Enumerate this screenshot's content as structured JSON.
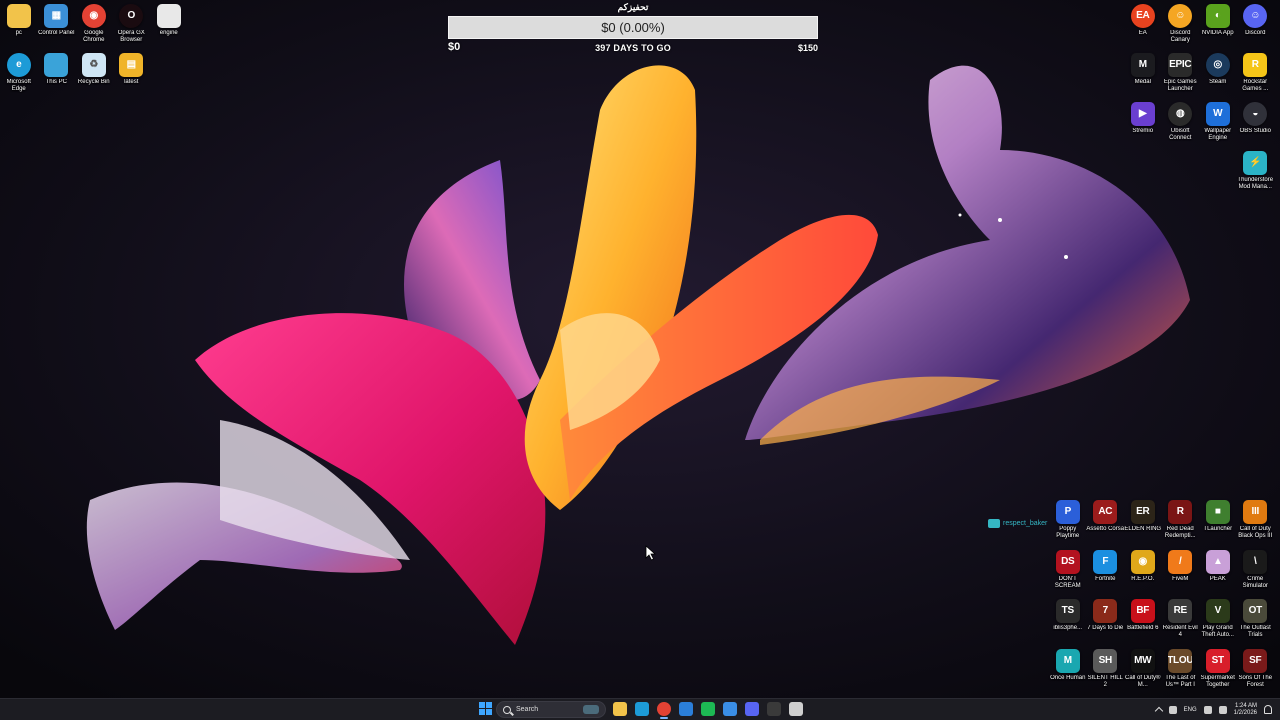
{
  "goal_widget": {
    "title": "تحفيزكم",
    "amount": "$0 (0.00%)",
    "progress_percent": 0.0,
    "min_label": "$0",
    "days_label": "397 DAYS TO GO",
    "max_label": "$150"
  },
  "desktop_left": [
    {
      "label": "pc",
      "icon": "folder-icon",
      "color": "#f2c34a",
      "glyph": ""
    },
    {
      "label": "Control Panel",
      "icon": "control-panel-icon",
      "color": "#3b8fd6",
      "glyph": "▦"
    },
    {
      "label": "Google Chrome",
      "icon": "chrome-icon",
      "color": "#e34234",
      "glyph": "◉",
      "round": true
    },
    {
      "label": "Opera GX Browser",
      "icon": "opera-gx-icon",
      "color": "#1a0b10",
      "glyph": "O",
      "round": true
    },
    {
      "label": "engine",
      "icon": "file-icon",
      "color": "#e8e8e8",
      "glyph": ""
    },
    {
      "label": "Microsoft Edge",
      "icon": "edge-icon",
      "color": "#1d9bd7",
      "glyph": "e",
      "round": true
    },
    {
      "label": "This PC",
      "icon": "monitor-icon",
      "color": "#3aa3d9",
      "glyph": ""
    },
    {
      "label": "Recycle Bin",
      "icon": "recycle-bin-icon",
      "color": "#cfe6f5",
      "glyph": "♻"
    },
    {
      "label": "latest",
      "icon": "zip-folder-icon",
      "color": "#f0b429",
      "glyph": "▤"
    }
  ],
  "desktop_right_top": [
    {
      "label": "EA",
      "icon": "ea-icon",
      "color": "#e8431f",
      "glyph": "EA",
      "round": true
    },
    {
      "label": "Discord Canary",
      "icon": "discord-canary-icon",
      "color": "#f5a623",
      "glyph": "☺",
      "round": true
    },
    {
      "label": "NVIDIA App",
      "icon": "nvidia-icon",
      "color": "#5aa21d",
      "glyph": "◐"
    },
    {
      "label": "Discord",
      "icon": "discord-icon",
      "color": "#5865f2",
      "glyph": "☺",
      "round": true
    },
    {
      "label": "Medal",
      "icon": "medal-icon",
      "color": "#1b1b1f",
      "glyph": "M"
    },
    {
      "label": "Epic Games Launcher",
      "icon": "epic-games-icon",
      "color": "#2a2a2a",
      "glyph": "EPIC"
    },
    {
      "label": "Steam",
      "icon": "steam-icon",
      "color": "#1b3a5c",
      "glyph": "◎",
      "round": true
    },
    {
      "label": "Rockstar Games ...",
      "icon": "rockstar-icon",
      "color": "#f5c518",
      "glyph": "R"
    },
    {
      "label": "Stremio",
      "icon": "stremio-icon",
      "color": "#6a3fd0",
      "glyph": "▶"
    },
    {
      "label": "Ubisoft Connect",
      "icon": "ubisoft-icon",
      "color": "#2a2a2a",
      "glyph": "◍",
      "round": true
    },
    {
      "label": "Wallpaper Engine",
      "icon": "wallpaper-engine-icon",
      "color": "#1e6fd9",
      "glyph": "W"
    },
    {
      "label": "OBS Studio",
      "icon": "obs-icon",
      "color": "#30313a",
      "glyph": "◒",
      "round": true
    },
    {
      "label": "",
      "icon": "",
      "color": "",
      "glyph": "",
      "empty": true
    },
    {
      "label": "",
      "icon": "",
      "color": "",
      "glyph": "",
      "empty": true
    },
    {
      "label": "",
      "icon": "",
      "color": "",
      "glyph": "",
      "empty": true
    },
    {
      "label": "Thunderstore Mod Mana...",
      "icon": "thunderstore-icon",
      "color": "#2bb3c6",
      "glyph": "⚡"
    }
  ],
  "desktop_right_bottom": [
    {
      "label": "Poppy Playtime",
      "icon": "poppy-playtime-icon",
      "color": "#2b5fd9",
      "glyph": "P"
    },
    {
      "label": "Assetto Corsa",
      "icon": "assetto-corsa-icon",
      "color": "#9b1c1c",
      "glyph": "AC"
    },
    {
      "label": "ELDEN RING",
      "icon": "elden-ring-icon",
      "color": "#2c2418",
      "glyph": "ER"
    },
    {
      "label": "Red Dead Redempti...",
      "icon": "red-dead-icon",
      "color": "#7a1515",
      "glyph": "R"
    },
    {
      "label": "TLauncher",
      "icon": "tlauncher-icon",
      "color": "#3f7f2f",
      "glyph": "■"
    },
    {
      "label": "Call of Duty Black Ops III",
      "icon": "black-ops-icon",
      "color": "#e07a10",
      "glyph": "III"
    },
    {
      "label": "DON'T SCREAM",
      "icon": "dont-scream-icon",
      "color": "#b3121f",
      "glyph": "DS"
    },
    {
      "label": "Fortnite",
      "icon": "fortnite-icon",
      "color": "#1b8fe0",
      "glyph": "F"
    },
    {
      "label": "R.E.P.O.",
      "icon": "repo-icon",
      "color": "#e0a81a",
      "glyph": "◉"
    },
    {
      "label": "FiveM",
      "icon": "fivem-icon",
      "color": "#f07a1a",
      "glyph": "/"
    },
    {
      "label": "PEAK",
      "icon": "peak-icon",
      "color": "#c9a0d8",
      "glyph": "▲"
    },
    {
      "label": "Crime Simulator",
      "icon": "crime-simulator-icon",
      "color": "#1a1a1a",
      "glyph": "\\"
    },
    {
      "label": "iblis3phe...",
      "icon": "iblis-icon",
      "color": "#2a2a2a",
      "glyph": "TS"
    },
    {
      "label": "7 Days to Die",
      "icon": "seven-days-icon",
      "color": "#8a2a1a",
      "glyph": "7"
    },
    {
      "label": "Battlefield 6",
      "icon": "battlefield-icon",
      "color": "#c8101a",
      "glyph": "BF"
    },
    {
      "label": "Resident Evil 4",
      "icon": "resident-evil-icon",
      "color": "#3a3a3a",
      "glyph": "RE"
    },
    {
      "label": "Play Grand Theft Auto...",
      "icon": "gta-icon",
      "color": "#2b3a1a",
      "glyph": "V"
    },
    {
      "label": "The Outlast Trials",
      "icon": "outlast-icon",
      "color": "#4a4a3a",
      "glyph": "OT"
    },
    {
      "label": "Once Human",
      "icon": "once-human-icon",
      "color": "#1aa7b0",
      "glyph": "M"
    },
    {
      "label": "SILENT HILL 2",
      "icon": "silent-hill-icon",
      "color": "#5a5a5a",
      "glyph": "SH"
    },
    {
      "label": "Call of Duty® M...",
      "icon": "call-of-duty-mw-icon",
      "color": "#111111",
      "glyph": "MW"
    },
    {
      "label": "The Last of Us™ Part I",
      "icon": "last-of-us-icon",
      "color": "#6a4a2a",
      "glyph": "TLOU"
    },
    {
      "label": "Supermarket Together",
      "icon": "supermarket-icon",
      "color": "#d81e2a",
      "glyph": "ST"
    },
    {
      "label": "Sons Of The Forest",
      "icon": "sons-forest-icon",
      "color": "#7a1a1a",
      "glyph": "SF"
    }
  ],
  "overlay_badge": {
    "text": "respect_baker"
  },
  "taskbar": {
    "search_label": "Search",
    "apps": [
      {
        "name": "file-explorer-icon",
        "color": "#f2c34a"
      },
      {
        "name": "edge-icon",
        "color": "#1d9bd7"
      },
      {
        "name": "store-icon",
        "color": "#2b7fd9"
      },
      {
        "name": "spotify-icon",
        "color": "#1db954"
      },
      {
        "name": "mail-icon",
        "color": "#3a8ee6"
      },
      {
        "name": "discord-icon",
        "color": "#5865f2"
      },
      {
        "name": "terminal-icon",
        "color": "#3a3a3a"
      },
      {
        "name": "obs-icon",
        "color": "#cfcfcf"
      }
    ],
    "active_apps": [
      "chrome-icon"
    ],
    "language": "ENG",
    "time": "1:24 AM",
    "date": "1/2/2026"
  },
  "colors": {
    "taskbar_bg": "#1c1c22",
    "progress_fill": "#5a9b3e",
    "accent": "#3ea6ff"
  }
}
